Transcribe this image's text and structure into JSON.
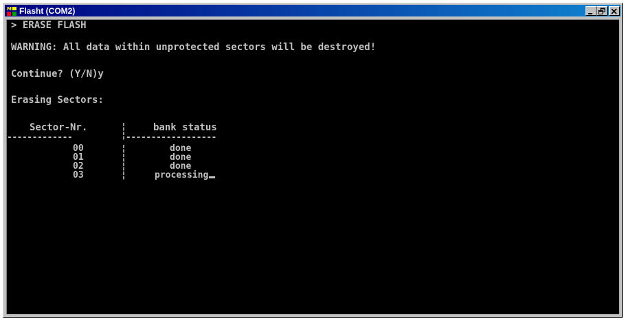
{
  "window": {
    "title": "Flasht (COM2)",
    "app_icon": "ms-dos-icon",
    "buttons": {
      "minimize": "minimize-icon",
      "maximize": "restore-icon",
      "close": "close-icon"
    }
  },
  "console": {
    "prompt_line": "> ERASE FLASH",
    "warning": "WARNING: All data within unprotected sectors will be destroyed!",
    "confirm": "Continue? (Y/N)y",
    "erasing": "Erasing Sectors:",
    "table": {
      "headers": [
        "Sector-Nr.",
        "bank status"
      ],
      "separator_left": "-------------",
      "separator_right": "------------------",
      "divider": "¦",
      "rows": [
        {
          "sector": "00",
          "status": "done"
        },
        {
          "sector": "01",
          "status": "done"
        },
        {
          "sector": "02",
          "status": "done"
        },
        {
          "sector": "03",
          "status": "processing"
        }
      ]
    },
    "colors": {
      "background": "#000000",
      "text": "#c0c0c0",
      "titlebar": "#000080"
    }
  }
}
